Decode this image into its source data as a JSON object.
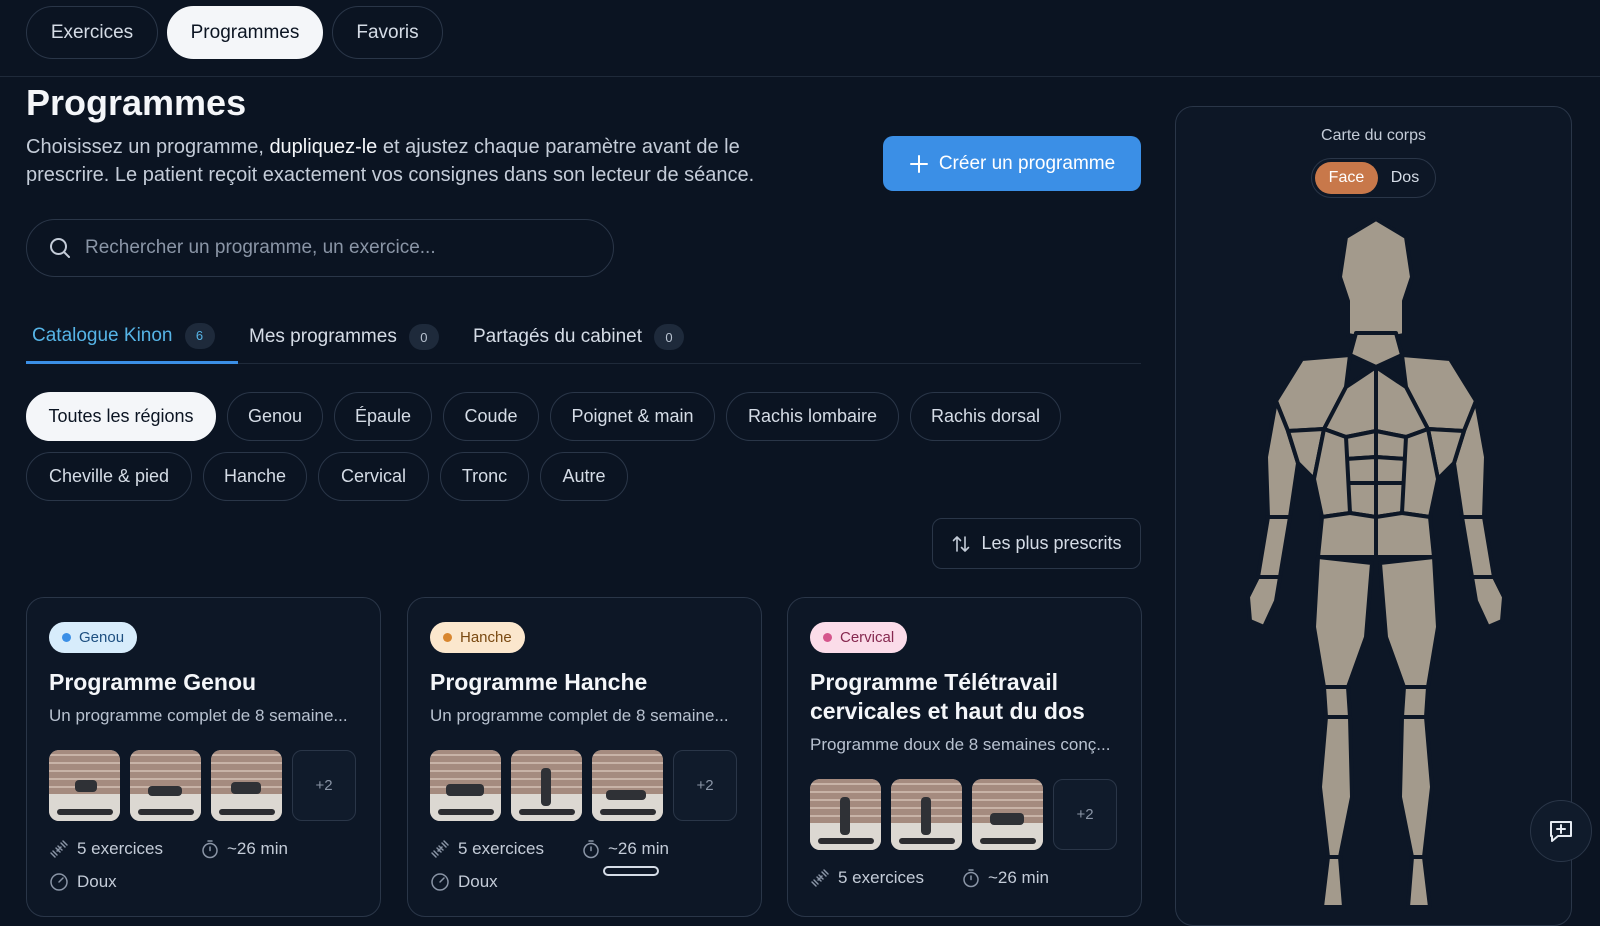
{
  "top_tabs": [
    "Exercices",
    "Programmes",
    "Favoris"
  ],
  "page_title": "Programmes",
  "description": {
    "part1": "Choisissez un programme, ",
    "bold": "dupliquez-le",
    "part2": " et ajustez chaque paramètre avant de le prescrire. Le patient reçoit exactement vos consignes dans son lecteur de séance."
  },
  "create_button": "Créer un programme",
  "search": {
    "placeholder": "Rechercher un programme, un exercice..."
  },
  "tabs": [
    {
      "label": "Catalogue Kinon",
      "count": "6"
    },
    {
      "label": "Mes programmes",
      "count": "0"
    },
    {
      "label": "Partagés du cabinet",
      "count": "0"
    }
  ],
  "regions": [
    "Toutes les régions",
    "Genou",
    "Épaule",
    "Coude",
    "Poignet & main",
    "Rachis lombaire",
    "Rachis dorsal",
    "Cheville & pied",
    "Hanche",
    "Cervical",
    "Tronc",
    "Autre"
  ],
  "sort_label": "Les plus prescrits",
  "cards": [
    {
      "badge": "Genou",
      "title": "Programme Genou",
      "desc": "Un programme complet de 8 semaine...",
      "more": "+2",
      "exercises": "5 exercices",
      "duration": "~26 min",
      "level": "Doux"
    },
    {
      "badge": "Hanche",
      "title": "Programme Hanche",
      "desc": "Un programme complet de 8 semaine...",
      "more": "+2",
      "exercises": "5 exercices",
      "duration": "~26 min",
      "level": "Doux"
    },
    {
      "badge": "Cervical",
      "title": "Programme Télétravail cervicales et haut du dos",
      "desc": "Programme doux de 8 semaines conç...",
      "more": "+2",
      "exercises": "5 exercices",
      "duration": "~26 min",
      "level": ""
    }
  ],
  "colors": {
    "genou": "#3b8fe6",
    "genou_bg": "#d7ecfb",
    "hanche": "#d8862f",
    "hanche_bg": "#fbe7cd",
    "cervical": "#d5558c",
    "cervical_bg": "#fbdce9",
    "accent": "#3b8fe6"
  },
  "body_map": {
    "title": "Carte du corps",
    "face": "Face",
    "back": "Dos"
  }
}
